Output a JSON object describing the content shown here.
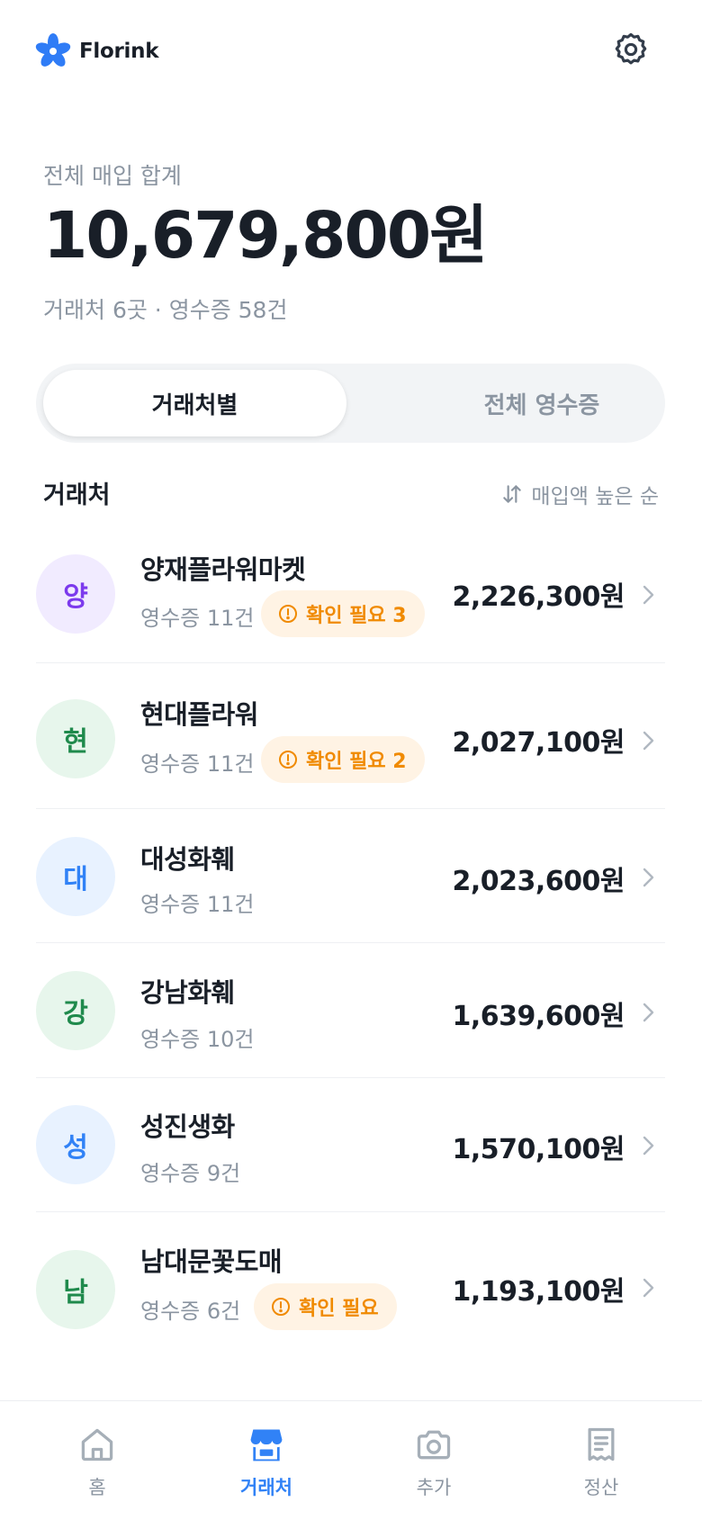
{
  "app": {
    "name": "Florink"
  },
  "summary": {
    "label": "전체 매입 합계",
    "total": "10,679,800원",
    "subtitle": "거래처 6곳 · 영수증 58건"
  },
  "tabs": {
    "by_vendor": "거래처별",
    "all_receipts": "전체 영수증"
  },
  "list": {
    "title": "거래처",
    "sort_label": "매입액 높은 순",
    "vendors": [
      {
        "initial": "양",
        "name": "양재플라워마켓",
        "receipts": "영수증 11건",
        "badge": "확인 필요 3",
        "amount": "2,226,300원"
      },
      {
        "initial": "현",
        "name": "현대플라워",
        "receipts": "영수증 11건",
        "badge": "확인 필요 2",
        "amount": "2,027,100원"
      },
      {
        "initial": "대",
        "name": "대성화훼",
        "receipts": "영수증 11건",
        "badge": "",
        "amount": "2,023,600원"
      },
      {
        "initial": "강",
        "name": "강남화훼",
        "receipts": "영수증 10건",
        "badge": "",
        "amount": "1,639,600원"
      },
      {
        "initial": "성",
        "name": "성진생화",
        "receipts": "영수증 9건",
        "badge": "",
        "amount": "1,570,100원"
      },
      {
        "initial": "남",
        "name": "남대문꽃도매",
        "receipts": "영수증 6건",
        "badge": "확인 필요",
        "amount": "1,193,100원"
      }
    ]
  },
  "nav": {
    "home": "홈",
    "vendors": "거래처",
    "add": "추가",
    "settlement": "정산"
  },
  "colors": {
    "accent": "#3182f6",
    "warning": "#f08a00",
    "text": "#191f28",
    "muted": "#8b95a1"
  }
}
